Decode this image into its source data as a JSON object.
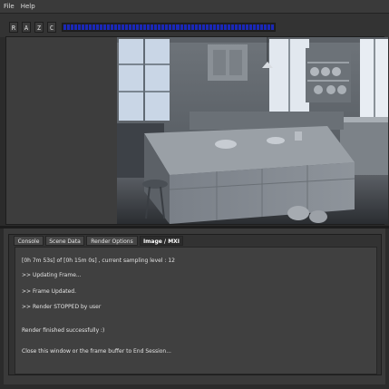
{
  "menu": {
    "file": "File",
    "help": "Help"
  },
  "toolbar": {
    "channels": [
      "R",
      "A",
      "Z",
      "C"
    ]
  },
  "tabs": [
    {
      "label": "Console"
    },
    {
      "label": "Scene Data"
    },
    {
      "label": "Render Options"
    },
    {
      "label": "Image / MXI"
    }
  ],
  "console": {
    "lines": [
      "[0h 7m 53s] of [0h 15m 0s] , current sampling level : 12",
      ">> Updating Frame...",
      ">> Frame Updated.",
      ">> Render STOPPED by user",
      "Render finished successfully :)",
      "Close this window or the frame buffer to End Session..."
    ]
  }
}
